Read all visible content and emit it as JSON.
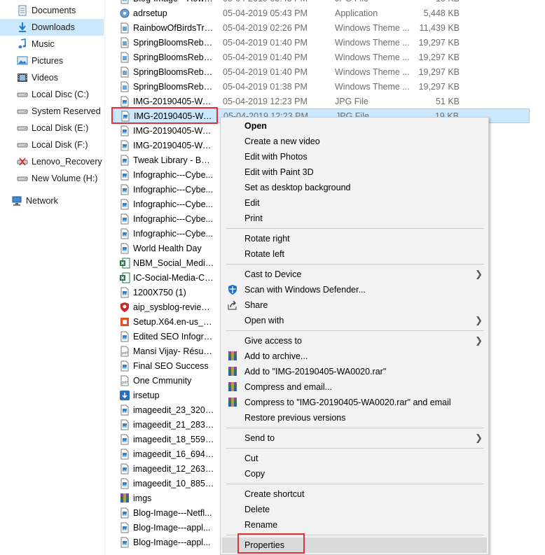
{
  "nav": {
    "items": [
      {
        "label": "Documents",
        "icon": "documents-icon"
      },
      {
        "label": "Downloads",
        "icon": "downloads-icon"
      },
      {
        "label": "Music",
        "icon": "music-icon"
      },
      {
        "label": "Pictures",
        "icon": "pictures-icon"
      },
      {
        "label": "Videos",
        "icon": "videos-icon"
      },
      {
        "label": "Local Disc (C:)",
        "icon": "drive-icon"
      },
      {
        "label": "System Reserved (D",
        "icon": "drive-icon"
      },
      {
        "label": "Local Disk (E:)",
        "icon": "drive-icon"
      },
      {
        "label": "Local Disk (F:)",
        "icon": "drive-icon"
      },
      {
        "label": "Lenovo_Recovery (G",
        "icon": "recovery-drive-icon"
      },
      {
        "label": "New Volume (H:)",
        "icon": "drive-icon"
      },
      {
        "label": "Network",
        "icon": "network-icon"
      }
    ]
  },
  "files": [
    {
      "name": "Blog-Image---Howit...",
      "date": "05-04-2019 05:43 PM",
      "type": "JPG File",
      "size": "10 KB",
      "icon": "image-file-icon"
    },
    {
      "name": "adrsetup",
      "date": "05-04-2019 05:43 PM",
      "type": "Application",
      "size": "5,448 KB",
      "icon": "setup-app-icon"
    },
    {
      "name": "RainbowOfBirdsTra...",
      "date": "05-04-2019 02:26 PM",
      "type": "Windows Theme ...",
      "size": "11,439 KB",
      "icon": "theme-file-icon"
    },
    {
      "name": "SpringBloomsRebe...",
      "date": "05-04-2019 01:40 PM",
      "type": "Windows Theme ...",
      "size": "19,297 KB",
      "icon": "theme-file-icon"
    },
    {
      "name": "SpringBloomsRebe...",
      "date": "05-04-2019 01:40 PM",
      "type": "Windows Theme ...",
      "size": "19,297 KB",
      "icon": "theme-file-icon"
    },
    {
      "name": "SpringBloomsRebe...",
      "date": "05-04-2019 01:40 PM",
      "type": "Windows Theme ...",
      "size": "19,297 KB",
      "icon": "theme-file-icon"
    },
    {
      "name": "SpringBloomsRebe...",
      "date": "05-04-2019 01:38 PM",
      "type": "Windows Theme ...",
      "size": "19,297 KB",
      "icon": "theme-file-icon"
    },
    {
      "name": "IMG-20190405-WA0...",
      "date": "05-04-2019 12:23 PM",
      "type": "JPG File",
      "size": "51 KB",
      "icon": "image-file-icon"
    },
    {
      "name": "IMG-20190405-WA0...",
      "date": "05-04-2019 12:23 PM",
      "type": "JPG File",
      "size": "19 KB",
      "icon": "image-file-icon"
    },
    {
      "name": "IMG-20190405-WA0...",
      "date": "",
      "type": "",
      "size": "",
      "icon": "image-file-icon"
    },
    {
      "name": "IMG-20190405-WA0...",
      "date": "",
      "type": "",
      "size": "",
      "icon": "image-file-icon"
    },
    {
      "name": "Tweak Library - Best...",
      "date": "",
      "type": "",
      "size": "",
      "icon": "image-file-icon"
    },
    {
      "name": "Infographic---Cybe...",
      "date": "",
      "type": "",
      "size": "",
      "icon": "image-file-icon"
    },
    {
      "name": "Infographic---Cybe...",
      "date": "",
      "type": "",
      "size": "",
      "icon": "image-file-icon"
    },
    {
      "name": "Infographic---Cybe...",
      "date": "",
      "type": "",
      "size": "",
      "icon": "image-file-icon"
    },
    {
      "name": "Infographic---Cybe...",
      "date": "",
      "type": "",
      "size": "",
      "icon": "image-file-icon"
    },
    {
      "name": "Infographic---Cybe...",
      "date": "",
      "type": "",
      "size": "",
      "icon": "image-file-icon"
    },
    {
      "name": "World Health Day",
      "date": "",
      "type": "",
      "size": "",
      "icon": "image-file-icon"
    },
    {
      "name": "NBM_Social_Media...",
      "date": "",
      "type": "",
      "size": "",
      "icon": "excel-file-icon"
    },
    {
      "name": "IC-Social-Media-Ca...",
      "date": "",
      "type": "",
      "size": "",
      "icon": "excel-file-icon"
    },
    {
      "name": "1200X750 (1)",
      "date": "",
      "type": "",
      "size": "",
      "icon": "image-file-icon"
    },
    {
      "name": "aip_sysblog-review...",
      "date": "",
      "type": "",
      "size": "",
      "icon": "shield-app-icon"
    },
    {
      "name": "Setup.X64.en-us_O3...",
      "date": "",
      "type": "",
      "size": "",
      "icon": "office-setup-icon"
    },
    {
      "name": "Edited SEO Infograp...",
      "date": "",
      "type": "",
      "size": "",
      "icon": "image-file-icon"
    },
    {
      "name": "Mansi Vijay- Résumé",
      "date": "",
      "type": "",
      "size": "",
      "icon": "pdf-file-icon"
    },
    {
      "name": "Final SEO Success",
      "date": "",
      "type": "",
      "size": "",
      "icon": "image-file-icon"
    },
    {
      "name": "One Cmmunity",
      "date": "",
      "type": "",
      "size": "",
      "icon": "pdf-file-icon"
    },
    {
      "name": "irsetup",
      "date": "",
      "type": "",
      "size": "",
      "icon": "installer-icon"
    },
    {
      "name": "imageedit_23_32004...",
      "date": "",
      "type": "",
      "size": "",
      "icon": "image-file-icon"
    },
    {
      "name": "imageedit_21_28358...",
      "date": "",
      "type": "",
      "size": "",
      "icon": "image-file-icon"
    },
    {
      "name": "imageedit_18_55902...",
      "date": "",
      "type": "",
      "size": "",
      "icon": "image-file-icon"
    },
    {
      "name": "imageedit_16_69443...",
      "date": "",
      "type": "",
      "size": "",
      "icon": "image-file-icon"
    },
    {
      "name": "imageedit_12_26306...",
      "date": "",
      "type": "",
      "size": "",
      "icon": "image-file-icon"
    },
    {
      "name": "imageedit_10_88516...",
      "date": "",
      "type": "",
      "size": "",
      "icon": "image-file-icon"
    },
    {
      "name": "imgs",
      "date": "",
      "type": "",
      "size": "",
      "icon": "winrar-archive-icon"
    },
    {
      "name": "Blog-Image---Netfl...",
      "date": "",
      "type": "",
      "size": "",
      "icon": "image-file-icon"
    },
    {
      "name": "Blog-Image---appl...",
      "date": "",
      "type": "",
      "size": "",
      "icon": "image-file-icon"
    },
    {
      "name": "Blog-Image---appl...",
      "date": "",
      "type": "",
      "size": "",
      "icon": "image-file-icon"
    }
  ],
  "context_menu": {
    "items": [
      {
        "label": "Open",
        "bold": true,
        "icon": "",
        "arrow": false
      },
      {
        "label": "Create a new video",
        "icon": "",
        "arrow": false
      },
      {
        "label": "Edit with Photos",
        "icon": "",
        "arrow": false
      },
      {
        "label": "Edit with Paint 3D",
        "icon": "",
        "arrow": false
      },
      {
        "label": "Set as desktop background",
        "icon": "",
        "arrow": false
      },
      {
        "label": "Edit",
        "icon": "",
        "arrow": false
      },
      {
        "label": "Print",
        "icon": "",
        "arrow": false
      },
      {
        "sep": true
      },
      {
        "label": "Rotate right",
        "icon": "",
        "arrow": false
      },
      {
        "label": "Rotate left",
        "icon": "",
        "arrow": false
      },
      {
        "sep": true
      },
      {
        "label": "Cast to Device",
        "icon": "",
        "arrow": true
      },
      {
        "label": "Scan with Windows Defender...",
        "icon": "defender-icon",
        "arrow": false
      },
      {
        "label": "Share",
        "icon": "share-icon",
        "arrow": false
      },
      {
        "label": "Open with",
        "icon": "",
        "arrow": true
      },
      {
        "sep": true
      },
      {
        "label": "Give access to",
        "icon": "",
        "arrow": true
      },
      {
        "label": "Add to archive...",
        "icon": "winrar-icon",
        "arrow": false
      },
      {
        "label": "Add to \"IMG-20190405-WA0020.rar\"",
        "icon": "winrar-icon",
        "arrow": false
      },
      {
        "label": "Compress and email...",
        "icon": "winrar-icon",
        "arrow": false
      },
      {
        "label": "Compress to \"IMG-20190405-WA0020.rar\" and email",
        "icon": "winrar-icon",
        "arrow": false
      },
      {
        "label": "Restore previous versions",
        "icon": "",
        "arrow": false
      },
      {
        "sep": true
      },
      {
        "label": "Send to",
        "icon": "",
        "arrow": true
      },
      {
        "sep": true
      },
      {
        "label": "Cut",
        "icon": "",
        "arrow": false
      },
      {
        "label": "Copy",
        "icon": "",
        "arrow": false
      },
      {
        "sep": true
      },
      {
        "label": "Create shortcut",
        "icon": "",
        "arrow": false
      },
      {
        "label": "Delete",
        "icon": "",
        "arrow": false
      },
      {
        "label": "Rename",
        "icon": "",
        "arrow": false
      },
      {
        "sep": true
      },
      {
        "label": "Properties",
        "icon": "",
        "arrow": false,
        "hover": true
      }
    ]
  },
  "colors": {
    "selection": "#cce8ff",
    "selection_border": "#99d1ff",
    "highlight_box": "#e0303a",
    "menu_bg": "#f2f2f2",
    "menu_hover": "#dadada"
  }
}
